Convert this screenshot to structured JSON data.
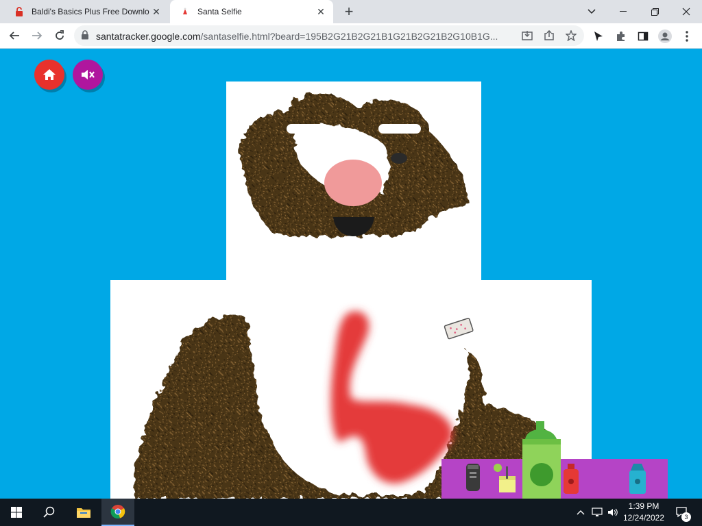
{
  "browser": {
    "tabs": [
      {
        "title": "Baldi's Basics Plus Free Downloac",
        "active": false
      },
      {
        "title": "Santa Selfie",
        "active": true
      }
    ],
    "url_host": "santatracker.google.com",
    "url_path": "/santaselfie.html?beard=195B2G21B2G21B1G21B2G21B2G10B1G..."
  },
  "page": {
    "background_color": "#00a8e6",
    "home_button_color": "#e8312c",
    "mute_button_color": "#b0169e",
    "tray_color": "#b544c6"
  },
  "taskbar": {
    "time": "1:39 PM",
    "date": "12/24/2022",
    "notification_count": "3"
  }
}
